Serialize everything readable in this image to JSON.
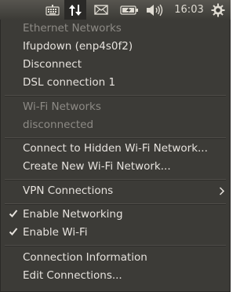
{
  "panel": {
    "indicators": [
      "keyboard-icon",
      "network-updown-icon",
      "mail-icon",
      "battery-icon",
      "volume-icon",
      "power-gear-icon"
    ],
    "clock": "16:03"
  },
  "menu": {
    "ethernet_header": "Ethernet Networks",
    "ifupdown": "Ifupdown (enp4s0f2)",
    "disconnect": "Disconnect",
    "dsl": "DSL connection 1",
    "wifi_header": "Wi-Fi Networks",
    "wifi_status": "disconnected",
    "connect_hidden": "Connect to Hidden Wi-Fi Network...",
    "create_new": "Create New Wi-Fi Network...",
    "vpn": "VPN Connections",
    "enable_networking": "Enable Networking",
    "enable_wifi": "Enable Wi-Fi",
    "connection_info": "Connection Information",
    "edit_connections": "Edit Connections..."
  },
  "colors": {
    "panel_bg": "#3c3b37",
    "menu_bg": "#3c3b37",
    "text": "#e6e2dd",
    "disabled_text": "#8d8a85"
  }
}
